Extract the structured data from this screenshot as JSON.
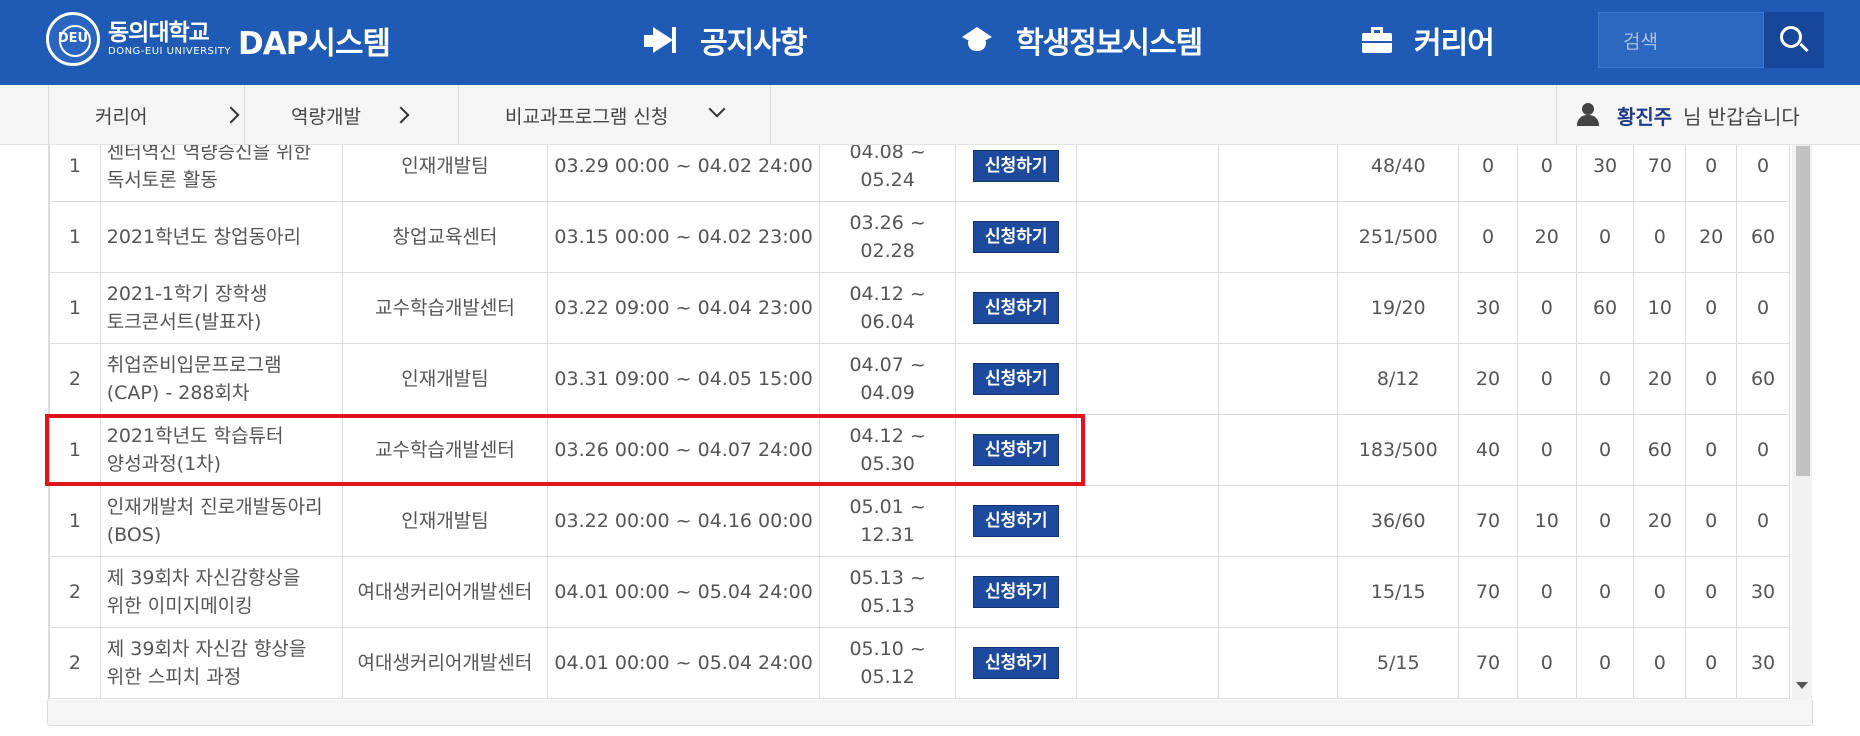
{
  "header": {
    "logo_mark": "DEU",
    "university_ko": "동의대학교",
    "university_en": "DONG-EUI UNIVERSITY",
    "system_title": "DAP시스템",
    "nav": [
      {
        "label": "공지사항",
        "icon": "megaphone-icon"
      },
      {
        "label": "학생정보시스템",
        "icon": "graduation-cap-icon"
      },
      {
        "label": "커리어",
        "icon": "briefcase-icon"
      }
    ],
    "search_placeholder": "검색",
    "brand_color": "#1f5bb5"
  },
  "breadcrumb": {
    "items": [
      {
        "label": "커리어"
      },
      {
        "label": "역량개발"
      },
      {
        "label": "비교과프로그램 신청"
      }
    ]
  },
  "user": {
    "name": "황진주",
    "greeting": "님 반갑습니다"
  },
  "table": {
    "apply_label": "신청하기",
    "rows": [
      {
        "no": "1",
        "name_l1": "센터역신 역량증신을 위한",
        "name_l2": "독서토론 활동",
        "dept": "인재개발팀",
        "apply_period": "03.29 00:00 ~ 04.02 24:00",
        "run_start": "04.08 ~",
        "run_end": "05.24",
        "quota": "48/40",
        "scores": [
          "0",
          "0",
          "30",
          "70",
          "0",
          "0"
        ]
      },
      {
        "no": "1",
        "name_l1": "2021학년도 창업동아리",
        "name_l2": "",
        "dept": "창업교육센터",
        "apply_period": "03.15 00:00 ~ 04.02 23:00",
        "run_start": "03.26 ~",
        "run_end": "02.28",
        "quota": "251/500",
        "scores": [
          "0",
          "20",
          "0",
          "0",
          "20",
          "60"
        ]
      },
      {
        "no": "1",
        "name_l1": "2021-1학기 장학생",
        "name_l2": "토크콘서트(발표자)",
        "dept": "교수학습개발센터",
        "apply_period": "03.22 09:00 ~ 04.04 23:00",
        "run_start": "04.12 ~",
        "run_end": "06.04",
        "quota": "19/20",
        "scores": [
          "30",
          "0",
          "60",
          "10",
          "0",
          "0"
        ]
      },
      {
        "no": "2",
        "name_l1": "취업준비입문프로그램",
        "name_l2": "(CAP) - 288회차",
        "dept": "인재개발팀",
        "apply_period": "03.31 09:00 ~ 04.05 15:00",
        "run_start": "04.07 ~",
        "run_end": "04.09",
        "quota": "8/12",
        "scores": [
          "20",
          "0",
          "0",
          "20",
          "0",
          "60"
        ]
      },
      {
        "no": "1",
        "name_l1": "2021학년도 학습튜터",
        "name_l2": "양성과정(1차)",
        "dept": "교수학습개발센터",
        "apply_period": "03.26 00:00 ~ 04.07 24:00",
        "run_start": "04.12 ~",
        "run_end": "05.30",
        "quota": "183/500",
        "scores": [
          "40",
          "0",
          "0",
          "60",
          "0",
          "0"
        ]
      },
      {
        "no": "1",
        "name_l1": "인재개발처 진로개발동아리",
        "name_l2": "(BOS)",
        "dept": "인재개발팀",
        "apply_period": "03.22 00:00 ~ 04.16 00:00",
        "run_start": "05.01 ~",
        "run_end": "12.31",
        "quota": "36/60",
        "scores": [
          "70",
          "10",
          "0",
          "20",
          "0",
          "0"
        ]
      },
      {
        "no": "2",
        "name_l1": "제 39회차 자신감향상을",
        "name_l2": "위한 이미지메이킹",
        "dept": "여대생커리어개발센터",
        "apply_period": "04.01 00:00 ~ 05.04 24:00",
        "run_start": "05.13 ~",
        "run_end": "05.13",
        "quota": "15/15",
        "scores": [
          "70",
          "0",
          "0",
          "0",
          "0",
          "30"
        ]
      },
      {
        "no": "2",
        "name_l1": "제 39회차 자신감 향상을",
        "name_l2": "위한 스피치 과정",
        "dept": "여대생커리어개발센터",
        "apply_period": "04.01 00:00 ~ 05.04 24:00",
        "run_start": "05.10 ~",
        "run_end": "05.12",
        "quota": "5/15",
        "scores": [
          "70",
          "0",
          "0",
          "0",
          "0",
          "30"
        ]
      }
    ]
  },
  "highlight_color": "#e0121c"
}
